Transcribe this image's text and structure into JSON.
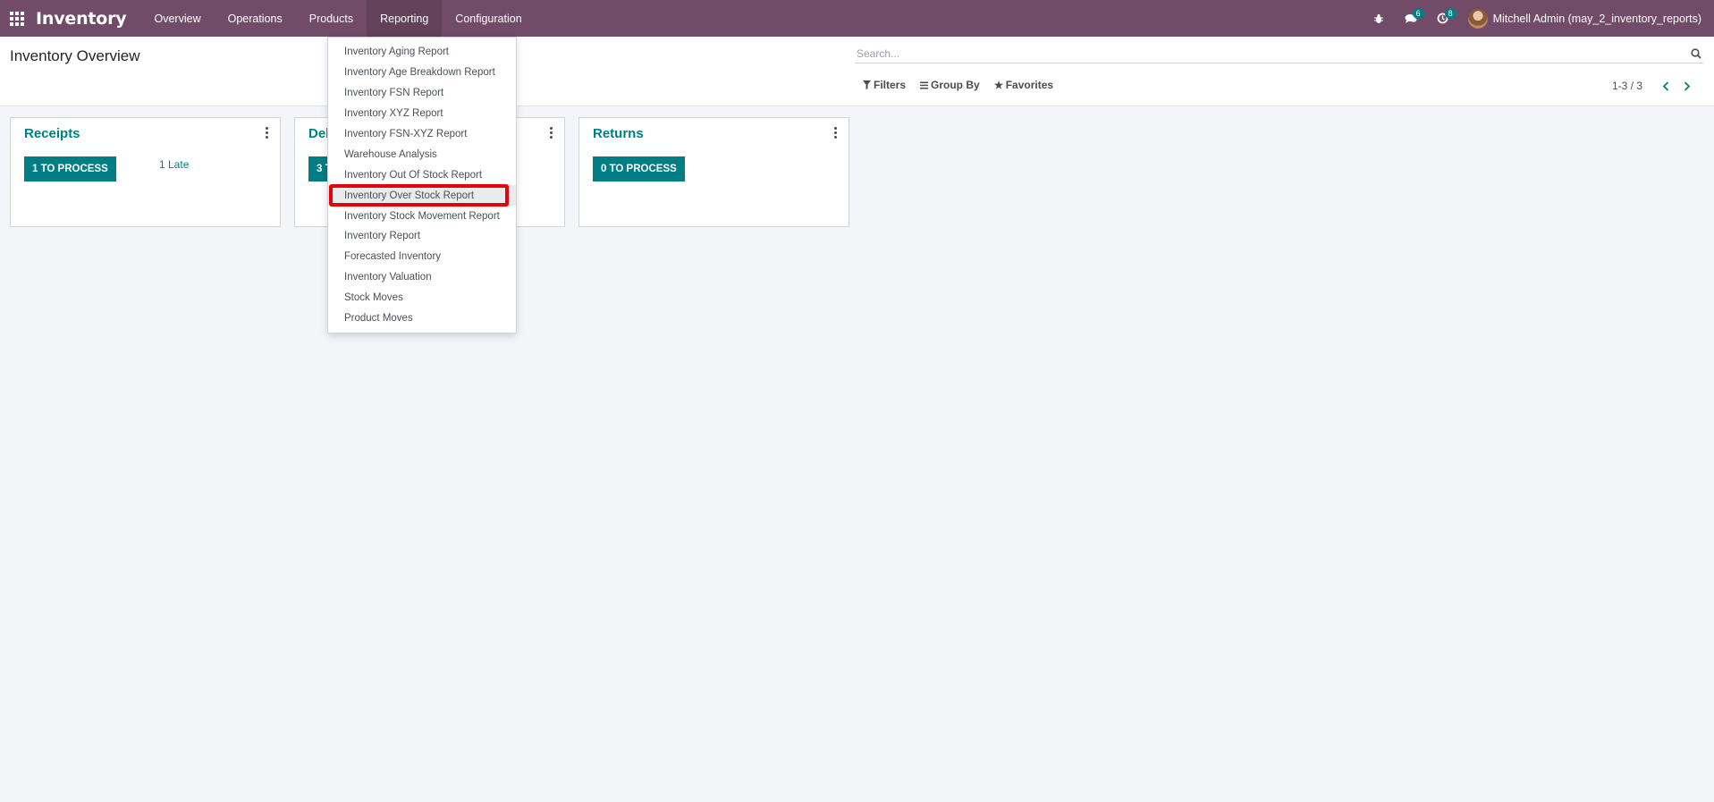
{
  "navbar": {
    "app_name": "Inventory",
    "menu": [
      {
        "label": "Overview"
      },
      {
        "label": "Operations"
      },
      {
        "label": "Products"
      },
      {
        "label": "Reporting"
      },
      {
        "label": "Configuration"
      }
    ],
    "active_menu": "Reporting",
    "messages_count": "6",
    "activities_count": "8",
    "user_name": "Mitchell Admin (may_2_inventory_reports)",
    "icons": [
      "apps-grid-icon",
      "bug-icon",
      "chat-icon",
      "clock-icon",
      "avatar"
    ]
  },
  "control_panel": {
    "title": "Inventory Overview",
    "search_placeholder": "Search...",
    "filters_label": "Filters",
    "group_by_label": "Group By",
    "favorites_label": "Favorites",
    "pager_value": "1-3 / 3"
  },
  "cards": [
    {
      "title": "Receipts",
      "button_label": "1 TO PROCESS",
      "late_label": "1 Late"
    },
    {
      "title": "Delivery Orders",
      "button_label": "3 TO PROCESS",
      "late_label": ""
    },
    {
      "title": "Returns",
      "button_label": "0 TO PROCESS",
      "late_label": ""
    }
  ],
  "reporting_menu": {
    "items": [
      {
        "label": "Inventory Aging Report"
      },
      {
        "label": "Inventory Age Breakdown Report"
      },
      {
        "label": "Inventory FSN Report"
      },
      {
        "label": "Inventory XYZ Report"
      },
      {
        "label": "Inventory FSN-XYZ Report"
      },
      {
        "label": "Warehouse Analysis"
      },
      {
        "label": "Inventory Out Of Stock Report"
      },
      {
        "label": "Inventory Over Stock Report"
      },
      {
        "label": "Inventory Stock Movement Report"
      },
      {
        "label": "Inventory Report"
      },
      {
        "label": "Forecasted Inventory"
      },
      {
        "label": "Inventory Valuation"
      },
      {
        "label": "Stock Moves"
      },
      {
        "label": "Product Moves"
      }
    ],
    "highlighted_item": "Inventory Over Stock Report"
  },
  "colors": {
    "navbar": "#714b67",
    "primary": "#017e84",
    "highlight_border": "#e8000b",
    "background": "#f4f5f8"
  }
}
